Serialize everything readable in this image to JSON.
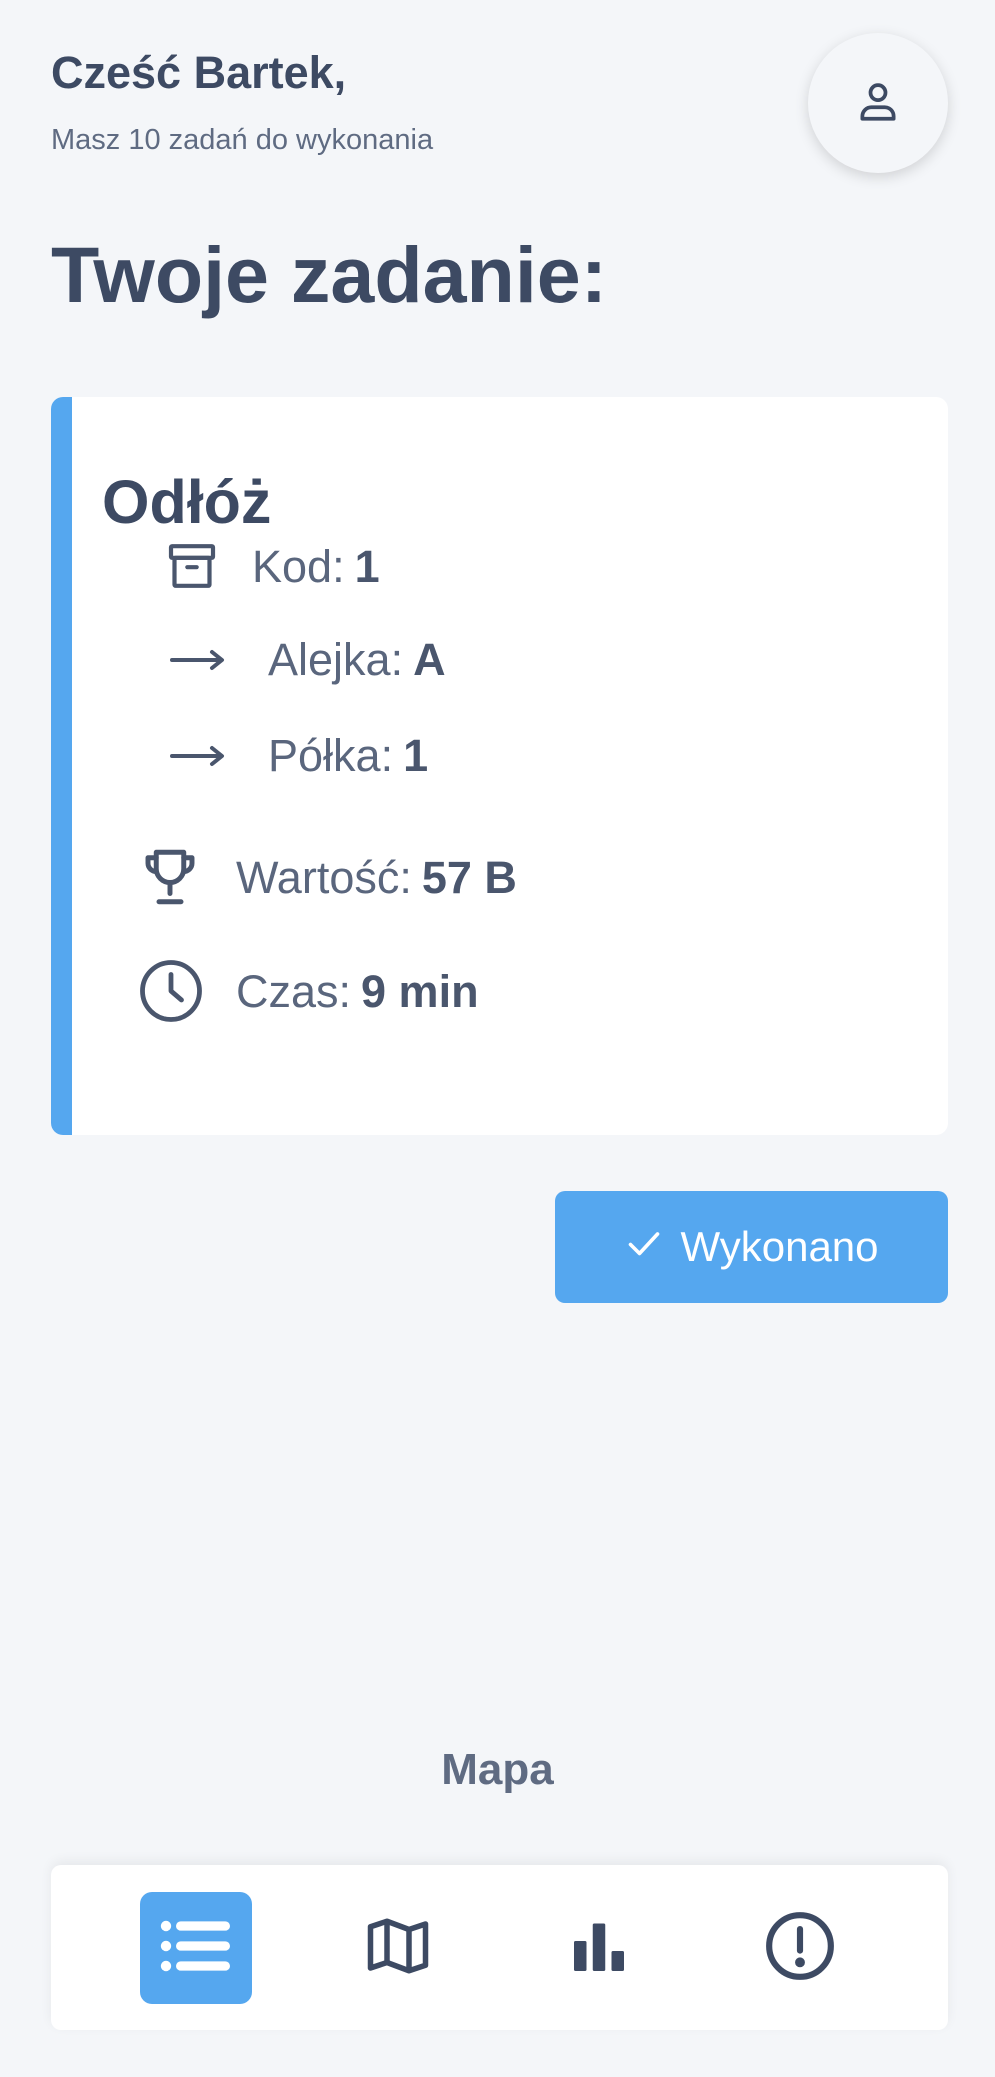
{
  "header": {
    "greeting": "Cześć Bartek,",
    "subtitle": "Masz 10 zadań do wykonania",
    "avatar_icon": "user-icon"
  },
  "page_title": "Twoje zadanie:",
  "task": {
    "title": "Odłóż",
    "accent_color": "#55a7ef",
    "rows": [
      {
        "icon": "archive-box-icon",
        "label": "Kod:",
        "value": "1"
      },
      {
        "icon": "arrow-right-icon",
        "label": "Alejka:",
        "value": "A"
      },
      {
        "icon": "arrow-right-icon",
        "label": "Półka:",
        "value": "1"
      },
      {
        "icon": "trophy-icon",
        "label": "Wartość:",
        "value": "57 B"
      },
      {
        "icon": "clock-icon",
        "label": "Czas:",
        "value": "9 min"
      }
    ]
  },
  "done_button": {
    "label": "Wykonano",
    "icon": "check-icon",
    "color": "#55a7ef"
  },
  "map_link": "Mapa",
  "bottom_nav": {
    "items": [
      {
        "name": "list-icon",
        "active": true
      },
      {
        "name": "map-icon",
        "active": false
      },
      {
        "name": "bar-chart-icon",
        "active": false
      },
      {
        "name": "alert-circle-icon",
        "active": false
      }
    ]
  }
}
